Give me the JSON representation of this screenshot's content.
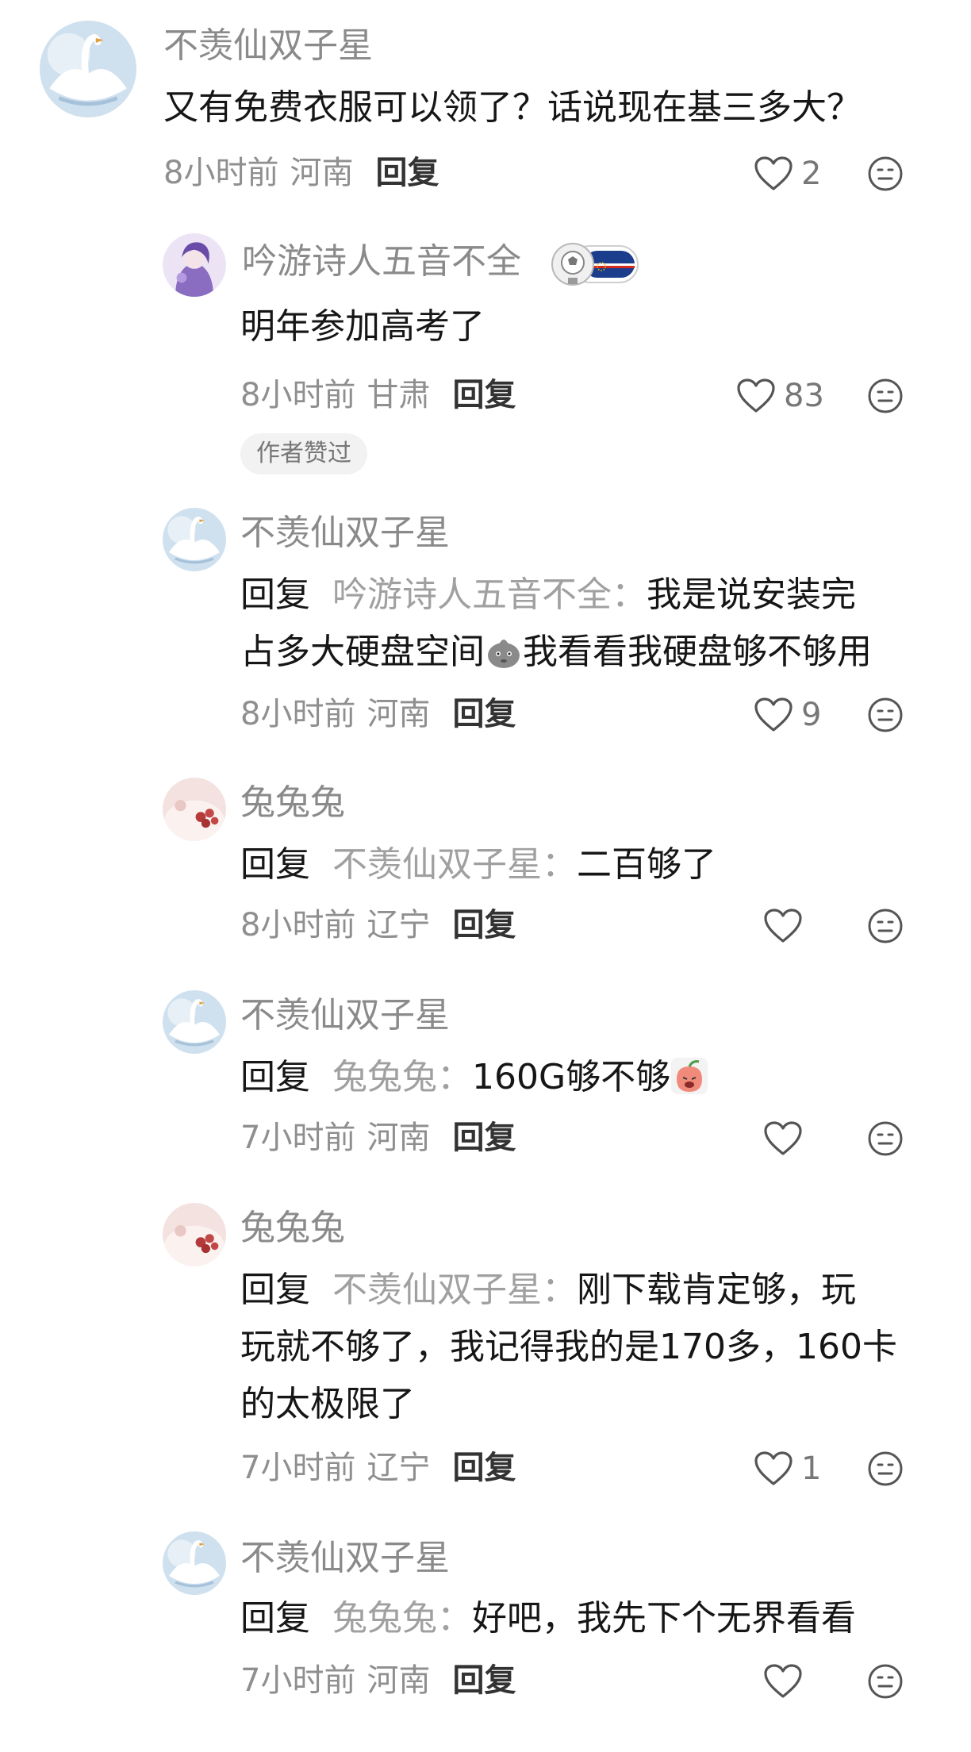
{
  "reply_label": "回复",
  "comments": [
    {
      "user": "不羡仙双子星",
      "text": "又有免费衣服可以领了？话说现在基三多大？",
      "time": "8小时前",
      "location": "河南",
      "likes": "2"
    },
    {
      "user": "吟游诗人五音不全",
      "text": "明年参加高考了",
      "time": "8小时前",
      "location": "甘肃",
      "likes": "83",
      "badge": "作者赞过"
    },
    {
      "user": "不羡仙双子星",
      "reply_to": "吟游诗人五音不全：",
      "text_part1": "我是说安装完",
      "text_line2a": "占多大硬盘空间",
      "text_line2b": "我看看我硬盘够不够用",
      "time": "8小时前",
      "location": "河南",
      "likes": "9"
    },
    {
      "user": "兔兔兔",
      "reply_to": "不羡仙双子星：",
      "text": "二百够了",
      "time": "8小时前",
      "location": "辽宁",
      "likes": ""
    },
    {
      "user": "不羡仙双子星",
      "reply_to": "兔兔兔：",
      "text": "160G够不够",
      "time": "7小时前",
      "location": "河南",
      "likes": ""
    },
    {
      "user": "兔兔兔",
      "reply_to": "不羡仙双子星：",
      "text_line1": "刚下载肯定够，玩",
      "text_line2": "玩就不够了，我记得我的是170多，160卡",
      "text_line3": "的太极限了",
      "time": "7小时前",
      "location": "辽宁",
      "likes": "1"
    },
    {
      "user": "不羡仙双子星",
      "reply_to": "兔兔兔：",
      "text": "好吧，我先下个无界看看",
      "time": "7小时前",
      "location": "河南",
      "likes": ""
    }
  ],
  "icons": {
    "like": "heart-outline-icon",
    "react": "emoji-face-icon",
    "avatar_swan": "swan-avatar",
    "avatar_bard": "purple-anime-avatar",
    "avatar_rabbit": "pink-floral-avatar",
    "badge_flag": "cape-verde-flag-badge",
    "emoji_blob": "gray-blob-emoji",
    "emoji_peach": "peach-face-emoji"
  }
}
